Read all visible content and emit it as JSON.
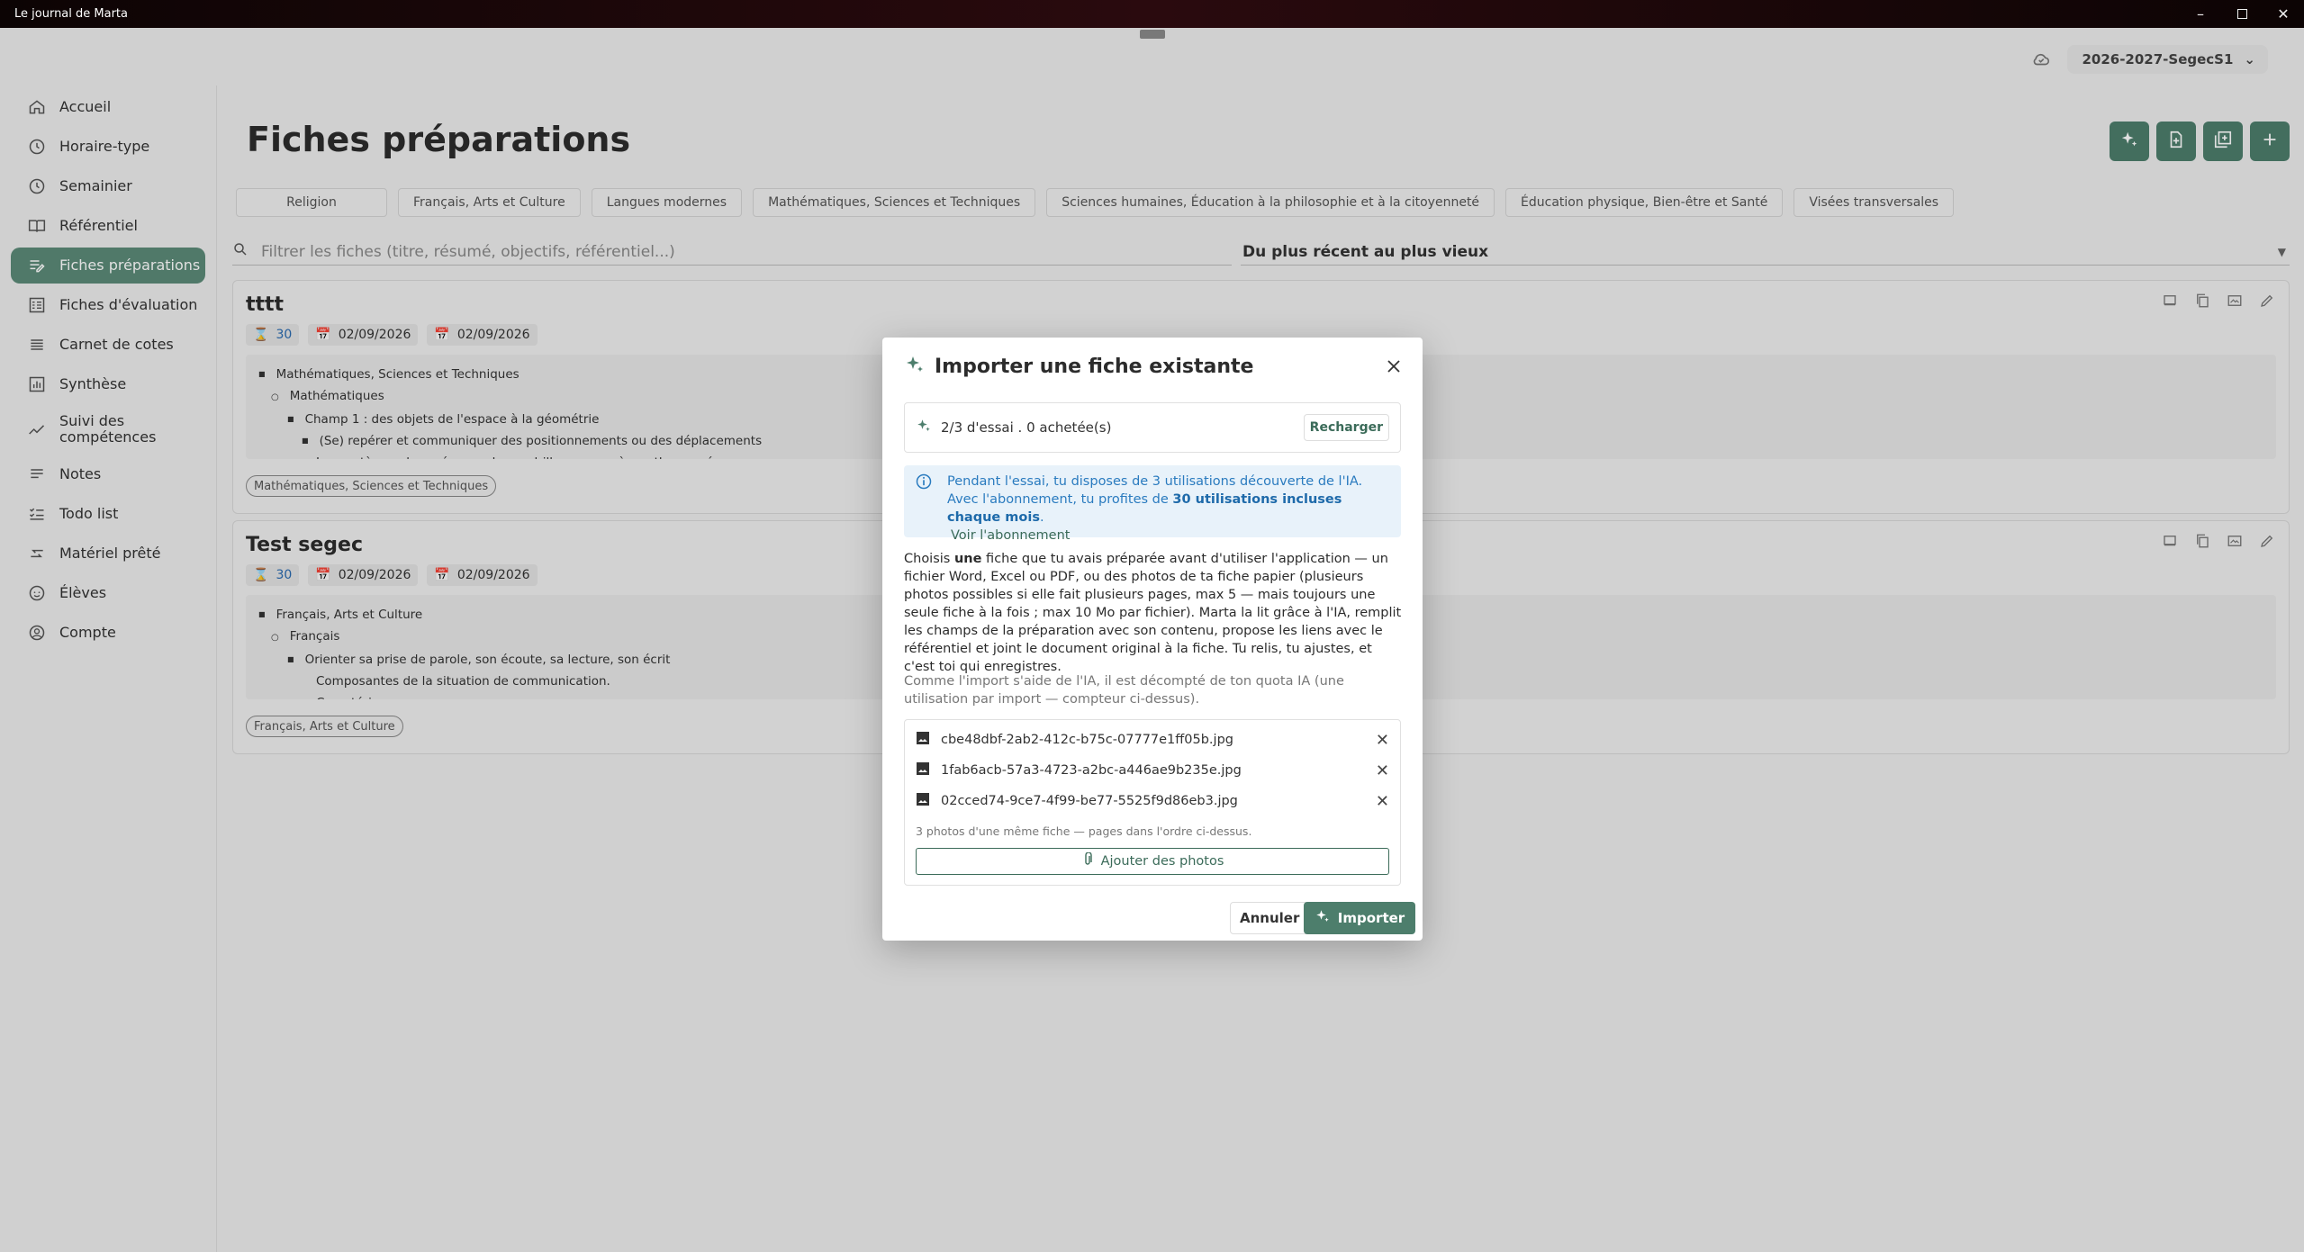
{
  "window": {
    "title": "Le journal de Marta"
  },
  "topbar": {
    "school_year": "2026-2027-SegecS1"
  },
  "sidebar": {
    "items": [
      {
        "label": "Accueil",
        "icon": "home-icon"
      },
      {
        "label": "Horaire-type",
        "icon": "clock-icon"
      },
      {
        "label": "Semainier",
        "icon": "clock-icon"
      },
      {
        "label": "Référentiel",
        "icon": "book-icon"
      },
      {
        "label": "Fiches préparations",
        "icon": "edit-list-icon",
        "active": true
      },
      {
        "label": "Fiches d'évaluation",
        "icon": "checklist-icon"
      },
      {
        "label": "Carnet de cotes",
        "icon": "list-icon"
      },
      {
        "label": "Synthèse",
        "icon": "bar-chart-icon"
      },
      {
        "label": "Suivi des compétences",
        "icon": "trend-icon"
      },
      {
        "label": "Notes",
        "icon": "notes-icon"
      },
      {
        "label": "Todo list",
        "icon": "todo-icon"
      },
      {
        "label": "Matériel prêté",
        "icon": "swap-icon"
      },
      {
        "label": "Élèves",
        "icon": "face-icon"
      },
      {
        "label": "Compte",
        "icon": "account-icon"
      }
    ]
  },
  "main": {
    "title": "Fiches préparations",
    "chips": [
      "Religion",
      "Français, Arts et Culture",
      "Langues modernes",
      "Mathématiques, Sciences et Techniques",
      "Sciences humaines, Éducation à la philosophie et à la citoyenneté",
      "Éducation physique, Bien-être et Santé",
      "Visées transversales"
    ],
    "filter_placeholder": "Filtrer les fiches (titre, résumé, objectifs, référentiel...)",
    "sort_value": "Du plus récent au plus vieux",
    "cards": [
      {
        "title": "tttt",
        "duration": "30",
        "date_start": "02/09/2026",
        "date_end": "02/09/2026",
        "lines": [
          "Mathématiques, Sciences et Techniques",
          "Mathématiques",
          "Champ 1 : des objets de l'espace à la géométrie",
          "(Se) repérer et communiquer des positionnements ou des déplacements",
          "Les systèmes de repérage : du quadrillage au repère orthonormé"
        ],
        "tag": "Mathématiques, Sciences et Techniques"
      },
      {
        "title": "Test segec",
        "duration": "30",
        "date_start": "02/09/2026",
        "date_end": "02/09/2026",
        "lines": [
          "Français, Arts et Culture",
          "Français",
          "Orienter sa prise de parole, son écoute, sa lecture, son écrit",
          "Composantes de la situation de communication.",
          "Caractériser :"
        ],
        "tag": "Français, Arts et Culture"
      }
    ]
  },
  "modal": {
    "title": "Importer une fiche existante",
    "quota_text": "2/3 d'essai . 0 achetée(s)",
    "reload_label": "Recharger",
    "info_part1": "Pendant l'essai, tu disposes de 3 utilisations découverte de l'IA. Avec l'abonnement, tu profites de ",
    "info_bold": "30 utilisations incluses chaque mois",
    "info_part2": ".",
    "info_link": "Voir l'abonnement",
    "desc_part1": "Choisis ",
    "desc_bold": "une",
    "desc_part2": " fiche que tu avais préparée avant d'utiliser l'application — un fichier Word, Excel ou PDF, ou des photos de ta fiche papier (plusieurs photos possibles si elle fait plusieurs pages, max 5 — mais toujours une seule fiche à la fois ; max 10 Mo par fichier). Marta la lit grâce à l'IA, remplit les champs de la préparation avec son contenu, propose les liens avec le référentiel et joint le document original à la fiche. Tu relis, tu ajustes, et c'est toi qui enregistres.",
    "note": "Comme l'import s'aide de l'IA, il est décompté de ton quota IA (une utilisation par import — compteur ci-dessus).",
    "files": [
      "cbe48dbf-2ab2-412c-b75c-07777e1ff05b.jpg",
      "1fab6acb-57a3-4723-a2bc-a446ae9b235e.jpg",
      "02cced74-9ce7-4f99-be77-5525f9d86eb3.jpg"
    ],
    "files_hint": "3 photos d'une même fiche — pages dans l'ordre ci-dessus.",
    "add_photos_label": "Ajouter des photos",
    "cancel_label": "Annuler",
    "import_label": "Importer"
  },
  "colors": {
    "accent": "#4d7e6c",
    "info": "#2a7bbf",
    "info_bg": "#e8f2fa"
  }
}
